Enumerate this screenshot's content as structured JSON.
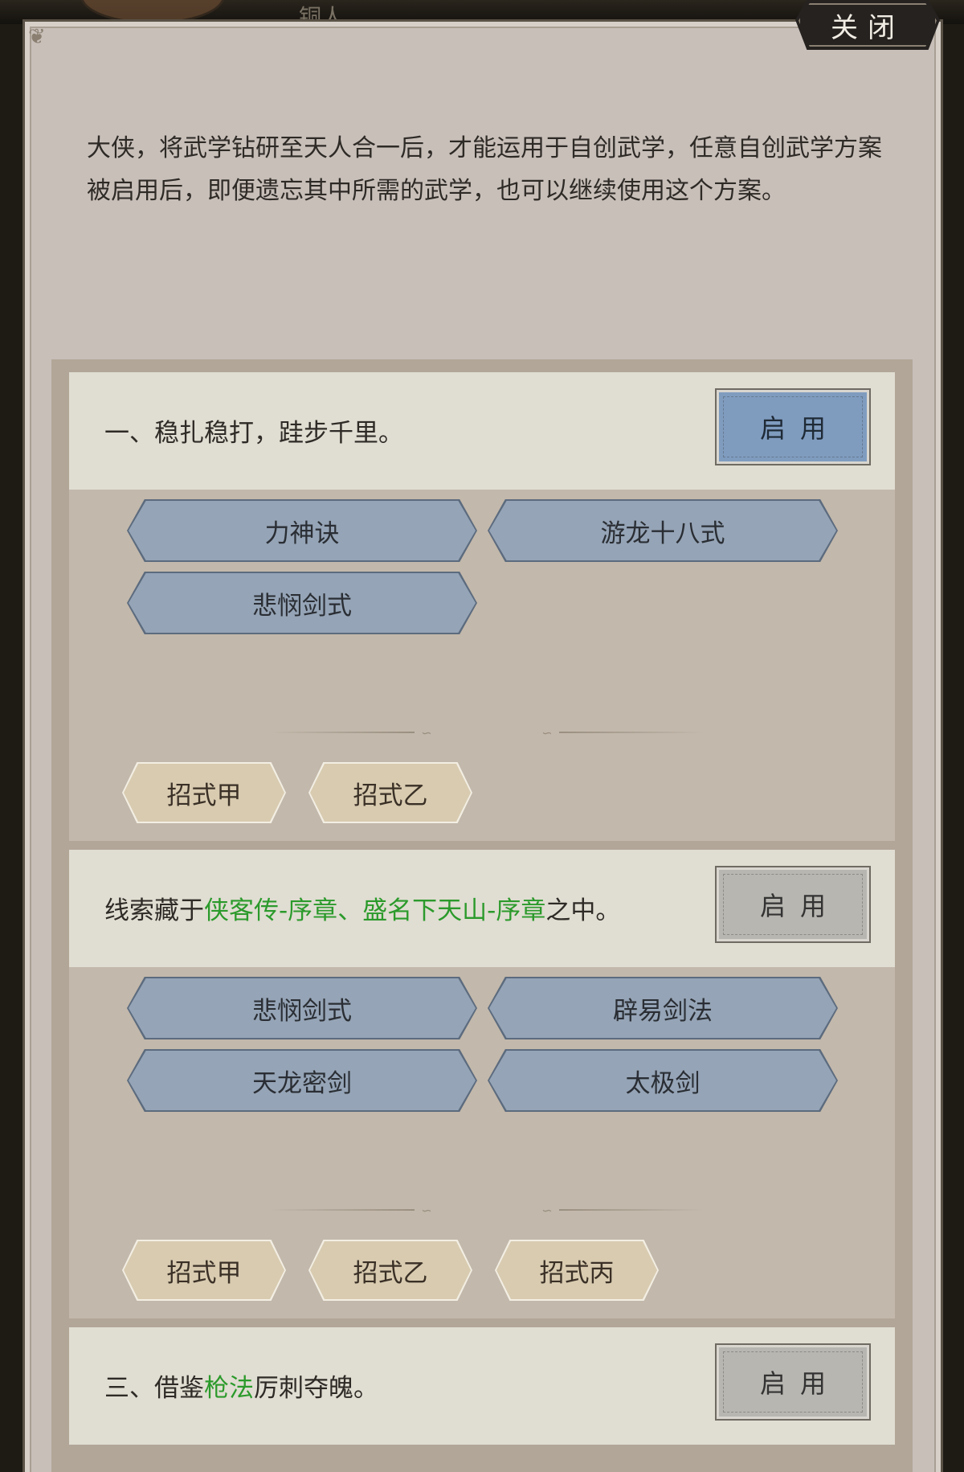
{
  "background": {
    "top_label": "铜人"
  },
  "close_button": {
    "label": "关闭"
  },
  "intro_text": "大侠，将武学钻研至天人合一后，才能运用于自创武学，任意自创武学方案被启用后，即便遗忘其中所需的武学，也可以继续使用这个方案。",
  "plans": [
    {
      "title": "一、稳扎稳打，跬步千里。",
      "enable_label": "启用",
      "enabled": true,
      "skills": [
        "力神诀",
        "游龙十八式",
        "悲悯剑式"
      ],
      "moves": [
        "招式甲",
        "招式乙"
      ]
    },
    {
      "title_parts": [
        "线索藏于",
        "侠客传-序章",
        "、",
        "盛名下天山-序章",
        "之中。"
      ],
      "enable_label": "启用",
      "enabled": false,
      "skills": [
        "悲悯剑式",
        "辟易剑法",
        "天龙密剑",
        "太极剑"
      ],
      "moves": [
        "招式甲",
        "招式乙",
        "招式丙"
      ]
    },
    {
      "title_parts": [
        "三、借鉴",
        "枪法",
        "厉刺夺魄。"
      ],
      "enable_label": "启用",
      "enabled": false
    }
  ],
  "colors": {
    "panel_bg": "#c8bfb9",
    "header_bg": "#e0ddd2",
    "body_bg": "#c2b8ab",
    "skill_tag": "#95a4b6",
    "move_tag": "#d8cbb0",
    "enable_active": "#7f9cbf",
    "enable_inactive": "#b8b6b1",
    "highlight_green": "#2b9a2b"
  }
}
